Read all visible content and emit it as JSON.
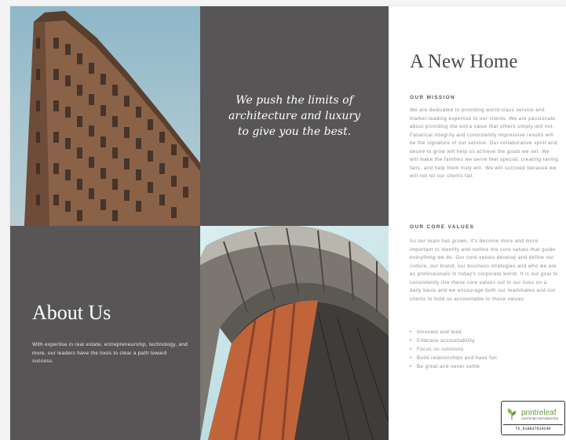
{
  "quote": "We push the limits of architecture and luxury to give you the best.",
  "about": {
    "title": "About Us",
    "body": "With expertise in real estate, entrepreneurship, technology, and more, our leaders have the tools to clear a path toward success."
  },
  "main": {
    "title": "A New Home",
    "mission_heading": "OUR MISSION",
    "mission_body": "We are dedicated to providing world-class service and market-leading expertise to our clients. We are passionate about providing the extra value that others simply will not. Fanatical integrity and consistently impressive results will be the signature of our service. Our collaborative spirit and desire to grow will help us achieve the goals we set. We will make the families we serve feel special, creating raving fans, and help them truly win. We will succeed because we will not let our clients fail.",
    "values_heading": "OUR CORE VALUES",
    "values_body": "As our team has grown, it's become more and more important to identify and outline the core values that guide everything we do. Our core values develop and define our culture, our brand, our business strategies and who we are as professionals in today's corporate world. It is our goal to consistently live these core values out in our lives on a daily basis and we encourage both our teammates and our clients to hold us accountable to these values.",
    "values": [
      "Innovate and lead",
      "Embrace accountability",
      "Focus on solutions",
      "Build relationships and have fun",
      "Be great and never settle"
    ]
  },
  "badge": {
    "name": "printreleaf",
    "subtitle": "CERTIFIED REFORESTED",
    "code": "TX_918837014249"
  },
  "images": {
    "building": "flatiron-building-photo",
    "arch": "curved-architecture-photo"
  },
  "colors": {
    "panel": "#585556",
    "sky": "#9fbfcb",
    "facade": "#8a6248",
    "copper": "#c2643a",
    "brand_green": "#6a9a3a"
  }
}
